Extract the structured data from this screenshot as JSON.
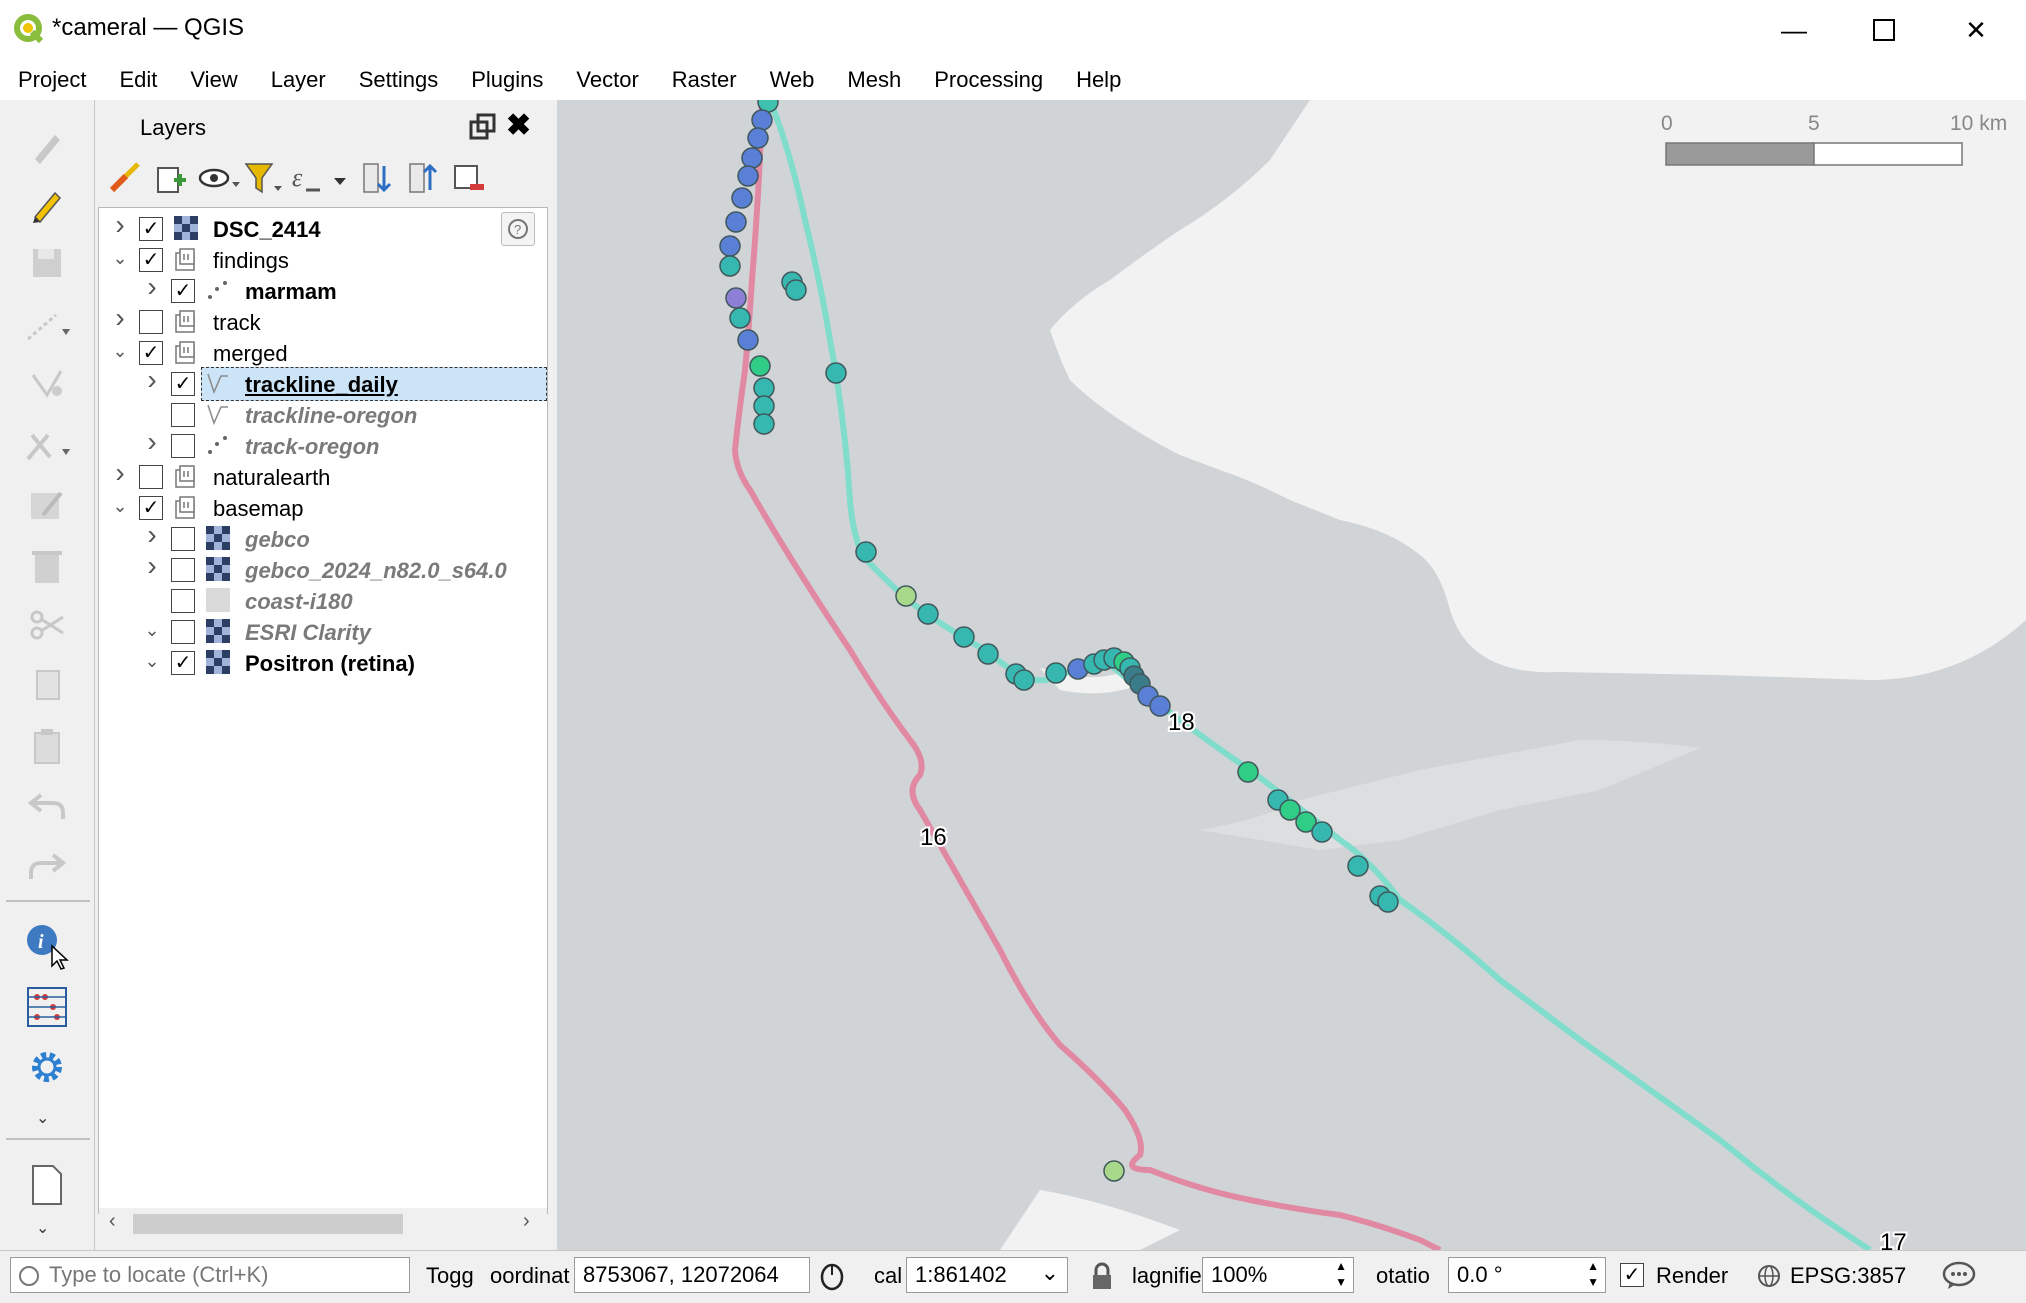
{
  "window": {
    "title": "*cameral — QGIS",
    "icon": "qgis-icon",
    "controls": [
      "minimize-icon",
      "maximize-icon",
      "close-icon"
    ]
  },
  "menu": [
    "Project",
    "Edit",
    "View",
    "Layer",
    "Settings",
    "Plugins",
    "Vector",
    "Raster",
    "Web",
    "Mesh",
    "Processing",
    "Help"
  ],
  "layers_panel": {
    "title": "Layers",
    "layers": [
      {
        "name": "DSC_2414",
        "checked": true,
        "expander": "collapsed",
        "icon": "raster-icon"
      },
      {
        "name": "findings",
        "checked": true,
        "expander": "expanded",
        "icon": "group-icon"
      },
      {
        "name": "marmam",
        "checked": true,
        "expander": "collapsed",
        "icon": "point-icon"
      },
      {
        "name": "track",
        "checked": false,
        "expander": "collapsed",
        "icon": "group-icon"
      },
      {
        "name": "merged",
        "checked": true,
        "expander": "expanded",
        "icon": "group-icon"
      },
      {
        "name": "trackline_daily",
        "checked": true,
        "expander": "collapsed",
        "icon": "line-icon",
        "selected": true
      },
      {
        "name": "trackline-oregon",
        "checked": false,
        "expander": "none",
        "icon": "line-icon"
      },
      {
        "name": "track-oregon",
        "checked": false,
        "expander": "collapsed",
        "icon": "point-icon"
      },
      {
        "name": "naturalearth",
        "checked": false,
        "expander": "collapsed",
        "icon": "group-icon"
      },
      {
        "name": "basemap",
        "checked": true,
        "expander": "expanded",
        "icon": "group-icon"
      },
      {
        "name": "gebco",
        "checked": false,
        "expander": "collapsed",
        "icon": "raster-icon"
      },
      {
        "name": "gebco_2024_n82.0_s64.0",
        "checked": false,
        "expander": "collapsed",
        "icon": "raster-icon"
      },
      {
        "name": "coast-i180",
        "checked": false,
        "expander": "none",
        "icon": "polygon-icon"
      },
      {
        "name": "ESRI Clarity",
        "checked": false,
        "expander": "expanded",
        "icon": "raster-icon"
      },
      {
        "name": "Positron (retina)",
        "checked": true,
        "expander": "expanded",
        "icon": "raster-icon"
      }
    ]
  },
  "map": {
    "scalebar": {
      "labels": [
        "0",
        "5",
        "10 km"
      ]
    },
    "labels": {
      "a": "16",
      "b": "18",
      "c": "17"
    }
  },
  "statusbar": {
    "locator_placeholder": "Type to locate (Ctrl+K)",
    "toggle": "Togg",
    "coord_label": "oordinat",
    "coord_value": "8753067, 12072064",
    "scale_label": "cal",
    "scale_value": "1:861402",
    "magnifier_label": "lagnifie",
    "magnifier_value": "100%",
    "rotation_label": "otatio",
    "rotation_value": "0.0 °",
    "render_label": "Render",
    "render_checked": true,
    "crs": "EPSG:3857"
  }
}
